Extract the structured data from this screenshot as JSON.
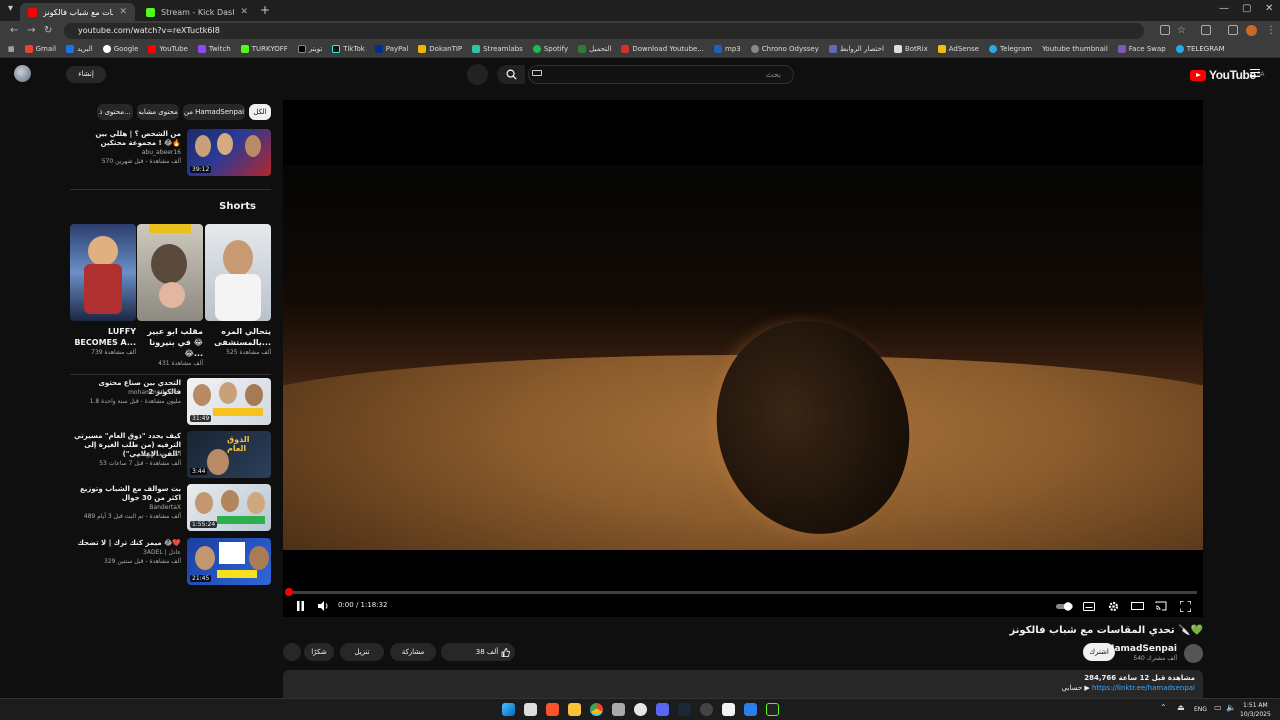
{
  "browser": {
    "tabs": [
      {
        "title": "تحدي المقاسات مع شباب فالكونز",
        "active": true
      },
      {
        "title": "Stream - Kick Dashboard",
        "active": false
      }
    ],
    "url": "youtube.com/watch?v=reXTuctk6I8",
    "bookmarks": [
      "Gmail",
      "البريد",
      "Google",
      "YouTube",
      "Twitch",
      "TURKYOFF",
      "تويتر",
      "TikTok",
      "PayPal",
      "DokanTIP",
      "Streamlabs",
      "Spotify",
      "التحميل",
      "Download Youtube...",
      "mp3",
      "Chrono Odyssey",
      "اختصار الروابط",
      "BotRix",
      "AdSense",
      "Telegram",
      "Youtube thumbnail",
      "Face Swap",
      "TELEGRAM"
    ]
  },
  "header": {
    "logo": "YouTube",
    "region": "SA",
    "search_placeholder": "بحث",
    "create_label": "إنشاء"
  },
  "player": {
    "time": "0:00 / 1:18:32",
    "progress_fraction": 0.0
  },
  "video": {
    "title": "تحدي المقاسات مع شباب فالكونز 🔪💚",
    "channel": "HamadSenpai",
    "subscribers": "540 ألف مشترك",
    "subscribe_label": "اشترك",
    "likes": "38 ألف",
    "share_label": "مشاركة",
    "download_label": "تنزيل",
    "thanks_label": "شكرًا",
    "views_line": "284,766 مشاهدة قبل 12 ساعة",
    "link_prefix": "حسابي ▶",
    "link_url": "https://linktr.ee/hamadsenpai"
  },
  "sidebar": {
    "chips": [
      "الكل",
      "من HamadSenpai",
      "محتوى مشابه",
      "محتوى ذ..."
    ],
    "top_video": {
      "title": "من الشخص ؟ | هللي بين مجموعة محتكين ! 😂🔥",
      "channel": "abu_abeer16",
      "meta": "570 ألف مشاهدة - قبل شهرين",
      "duration": "39:12"
    },
    "shorts_heading": "Shorts",
    "shorts": [
      {
        "title": "LUFFY BECOMES A...",
        "views": "739 ألف مشاهدة"
      },
      {
        "title": "مقلب ابو عبير في بنيرونا 😂😂...",
        "views": "431 ألف مشاهدة"
      },
      {
        "title": "يتحالي المره بالمستشفى...",
        "views": "525 ألف مشاهدة"
      }
    ],
    "videos": [
      {
        "title": "التحدي بين صناع محتوى فالكونز 2",
        "channel": "mohammed odeo",
        "meta": "1.8 مليون مشاهدة - قبل سنة واحدة",
        "duration": "31:49"
      },
      {
        "title": "كيف يحدد \"ذوق العام\" مسيرتي الترفيه (من طلب الغيرة إلى \"الفن الإعلامي\")",
        "channel": "أحمد سعد الزيعلي",
        "meta": "53 ألف مشاهدة - قبل 7 ساعات",
        "duration": "3:44"
      },
      {
        "title": "بث سوالف مع الشباب وتوزيع اكثر من 30 جوال",
        "channel": "BandertaX",
        "meta": "489 ألف مشاهدة - تم البث قبل 3 أيام",
        "duration": "1:55:24"
      },
      {
        "title": "ميمز كنك ترك | لا تضحك 😂❤️",
        "channel": "3ADEL | عادل",
        "meta": "329 ألف مشاهدة - قبل سنتين",
        "duration": "21:45"
      }
    ]
  },
  "taskbar": {
    "lang": "ENG",
    "time": "1:51 AM",
    "date": "10/3/2025"
  },
  "colors": {
    "brand_red": "#ff0000",
    "link_blue": "#3ea6ff",
    "background": "#0f0f0f"
  }
}
